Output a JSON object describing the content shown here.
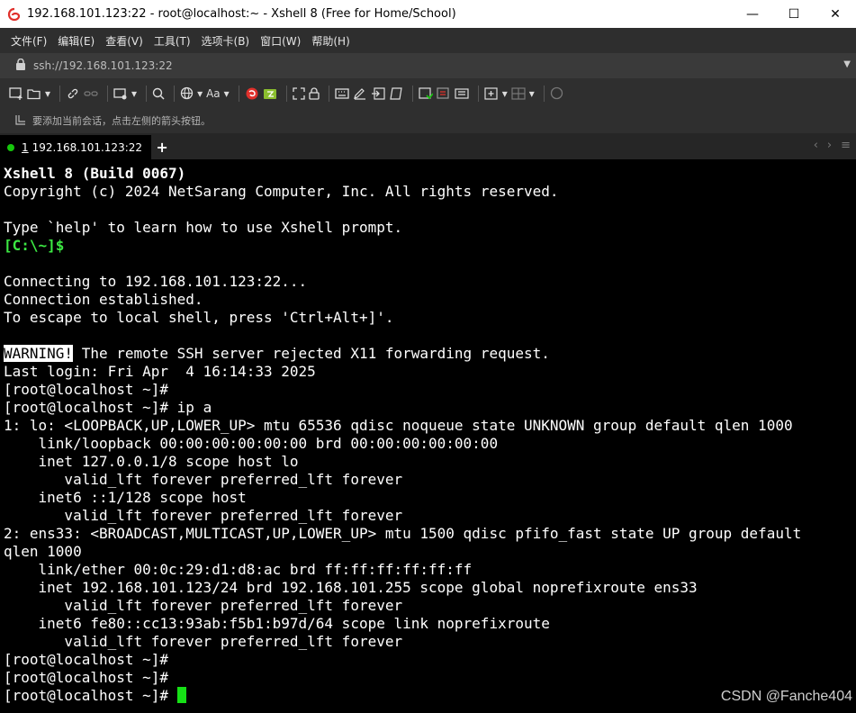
{
  "window": {
    "title": "192.168.101.123:22 - root@localhost:~ - Xshell 8 (Free for Home/School)",
    "minimize": "—",
    "maximize": "☐",
    "close": "✕"
  },
  "menu": [
    "文件(F)",
    "编辑(E)",
    "查看(V)",
    "工具(T)",
    "选项卡(B)",
    "窗口(W)",
    "帮助(H)"
  ],
  "address": {
    "value": "ssh://192.168.101.123:22"
  },
  "toolbar": {
    "font_label": "Aa"
  },
  "hint": {
    "text": "要添加当前会话，点击左侧的箭头按钮。"
  },
  "tabs": [
    {
      "number": "1",
      "label": "192.168.101.123:22",
      "status_color": "#16c60c"
    }
  ],
  "terminal": {
    "header_line1": "Xshell 8 (Build 0067)",
    "header_line2": "Copyright (c) 2024 NetSarang Computer, Inc. All rights reserved.",
    "help_line": "Type `help' to learn how to use Xshell prompt.",
    "local_prompt": "[C:\\~]$",
    "connecting": "Connecting to 192.168.101.123:22...",
    "established": "Connection established.",
    "escape": "To escape to local shell, press 'Ctrl+Alt+]'.",
    "warning_tag": "WARNING!",
    "warning_text": " The remote SSH server rejected X11 forwarding request.",
    "last_login": "Last login: Fri Apr  4 16:14:33 2025",
    "prompt": "[root@localhost ~]#",
    "cmd_ip": " ip a",
    "output": [
      "1: lo: <LOOPBACK,UP,LOWER_UP> mtu 65536 qdisc noqueue state UNKNOWN group default qlen 1000",
      "    link/loopback 00:00:00:00:00:00 brd 00:00:00:00:00:00",
      "    inet 127.0.0.1/8 scope host lo",
      "       valid_lft forever preferred_lft forever",
      "    inet6 ::1/128 scope host ",
      "       valid_lft forever preferred_lft forever",
      "2: ens33: <BROADCAST,MULTICAST,UP,LOWER_UP> mtu 1500 qdisc pfifo_fast state UP group default",
      "qlen 1000",
      "    link/ether 00:0c:29:d1:d8:ac brd ff:ff:ff:ff:ff:ff",
      "    inet 192.168.101.123/24 brd 192.168.101.255 scope global noprefixroute ens33",
      "       valid_lft forever preferred_lft forever",
      "    inet6 fe80::cc13:93ab:f5b1:b97d/64 scope link noprefixroute ",
      "       valid_lft forever preferred_lft forever"
    ],
    "cursor_color": "#16e016"
  },
  "watermark": "CSDN @Fanche404",
  "colors": {
    "chrome_bg": "#2f2f2f",
    "terminal_bg": "#000000",
    "prompt_green": "#3ce843"
  }
}
